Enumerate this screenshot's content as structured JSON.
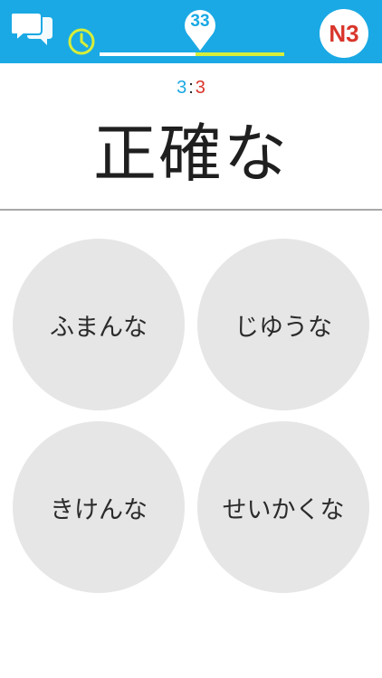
{
  "header": {
    "chat_icon": "chat-bubbles-icon",
    "timer_icon": "clock-icon",
    "progress_fraction": 0.52,
    "question_number": "33",
    "level_badge": "N3",
    "colors": {
      "bar": "#1aa9e4",
      "track_remaining": "#d6ee3a",
      "level": "#d9352b"
    }
  },
  "score": {
    "correct": "3",
    "separator": ":",
    "wrong": "3"
  },
  "question": {
    "text": "正確な"
  },
  "choices": [
    {
      "label": "ふまんな"
    },
    {
      "label": "じゆうな"
    },
    {
      "label": "きけんな"
    },
    {
      "label": "せいかくな"
    }
  ]
}
